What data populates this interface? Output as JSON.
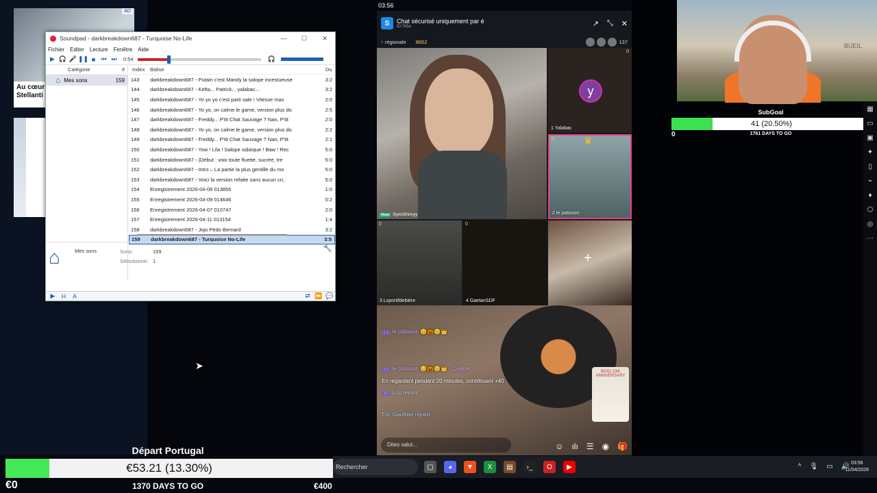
{
  "news": {
    "headline": "Au cœur\nStellanti",
    "badge": "AD"
  },
  "soundpad": {
    "title": "Soundpad - darkbreakdown687 - Turquoise No-Life",
    "window_controls": [
      "—",
      "☐",
      "✕"
    ],
    "menu": [
      "Fichier",
      "Editer",
      "Lecture",
      "Fenêtre",
      "Aide"
    ],
    "time": "0:54",
    "progress": 0.24,
    "category_header": "Catégorie",
    "category_count_header": "#",
    "category": {
      "name": "Mes sons",
      "count": "159"
    },
    "columns": {
      "index": "Index",
      "tag": "Balise",
      "duration": "Du"
    },
    "rows": [
      {
        "i": "143",
        "t": "darkbreakdown687 - Putain c'est Mandy la salope incestueuse",
        "d": "3:2"
      },
      {
        "i": "144",
        "t": "darkbreakdown687 - Kefta... Patrick... yalabac...",
        "d": "3:2"
      },
      {
        "i": "145",
        "t": "darkbreakdown687 - Yo yo yo c'est parti sale ! Vitesse max",
        "d": "2:0"
      },
      {
        "i": "146",
        "t": "darkbreakdown687 - Yo yo, on calme le game, version plus do",
        "d": "2:5"
      },
      {
        "i": "147",
        "t": "darkbreakdown687 - Freddy... P'tit Chat Sauvage ? Nan, P'tit",
        "d": "2:0"
      },
      {
        "i": "148",
        "t": "darkbreakdown687 - Yo yo, on calme le game, version plus do",
        "d": "2:2"
      },
      {
        "i": "149",
        "t": "darkbreakdown687 - Freddy... P'tit Chat Sauvage ? Nan, P'tit",
        "d": "2:1"
      },
      {
        "i": "150",
        "t": "darkbreakdown687 - Yow ! Lila ! Salope sidaïque ! Baw ! Rec",
        "d": "5:0"
      },
      {
        "i": "151",
        "t": "darkbreakdown687 - (Début : voix toute fluette, sucrée, tre",
        "d": "5:0"
      },
      {
        "i": "152",
        "t": "darkbreakdown687 - Intro – La partie la plus gentille du mo",
        "d": "5:0"
      },
      {
        "i": "153",
        "t": "darkbreakdown687 - Voici la version refaite sans aucun cri,",
        "d": "5:0"
      },
      {
        "i": "154",
        "t": "Enregistrement 2026-04-08 013855",
        "d": "1:0"
      },
      {
        "i": "155",
        "t": "Enregistrement 2026-04-09 014646",
        "d": "0:2"
      },
      {
        "i": "156",
        "t": "Enregistrement 2026-04-07 010747",
        "d": "2:0"
      },
      {
        "i": "157",
        "t": "Enregistrement 2026-04-11 013154",
        "d": "1:4"
      },
      {
        "i": "158",
        "t": "darkbreakdown687 - Jojo Pédo Bernard",
        "d": "3:2"
      },
      {
        "i": "159",
        "t": "darkbreakdown687 - Turquoise No-Life",
        "d": "3:5"
      }
    ],
    "info_label": "Mes sons",
    "sounds_label": "Sons:",
    "sounds_value": "159",
    "selected_label": "Sélectionné:",
    "selected_value": "1"
  },
  "phone": {
    "time": "03:56"
  },
  "bigo": {
    "title": "Chat sécurisé uniquement par é",
    "id": "ID:7k5a",
    "region": "↑ régionale",
    "coins": "8652",
    "viewers": "137",
    "host_label": "Host",
    "host_name": "SynnShimyy",
    "guest1": "1  Yalabac",
    "guest1_initial": "y",
    "guest2": "2  le patisson",
    "guest3": "3  Lsportifdebière",
    "guest4": "4  GaetanSDF",
    "tile_counts": [
      "0",
      "0",
      "0",
      "0"
    ],
    "chat": [
      {
        "level": "13",
        "text": "le pâtisson 😊🎃😊👑"
      },
      {
        "level": "13",
        "text": "le pâtisson 😊🎃😊👑 · Québec"
      },
      {
        "text": "En regardant pendant 20 minutes, contribuant +40"
      },
      {
        "level": "10",
        "text": "Lou rejoint"
      },
      {
        "text": "Eric Gauthier rejoint"
      }
    ],
    "input_placeholder": "Dites salut...",
    "promo": "BIGO 10th ANNIVERSARY"
  },
  "webcam": {
    "sign": "BUEIL"
  },
  "subgoal": {
    "title": "SubGoal",
    "text": "41 (20.50%)",
    "fraction": 0.205,
    "min": "0",
    "days": "1761 DAYS TO GO",
    "max": "200"
  },
  "goal": {
    "title": "Départ Portugal",
    "text": "€53.21 (13.30%)",
    "fraction": 0.133,
    "min": "€0",
    "days": "1370 DAYS TO GO",
    "max": "€400"
  },
  "taskbar": {
    "search": "Rechercher",
    "apps": [
      "task-view",
      "discord",
      "brave",
      "excel",
      "winrar",
      "terminal",
      "opera",
      "youtube"
    ],
    "clock_time": "03:56",
    "clock_date": "11/04/2026"
  },
  "colors": {
    "accent": "#1d5fb8",
    "goal_fill": "#45e858",
    "bigo_pink": "#e8408c"
  }
}
